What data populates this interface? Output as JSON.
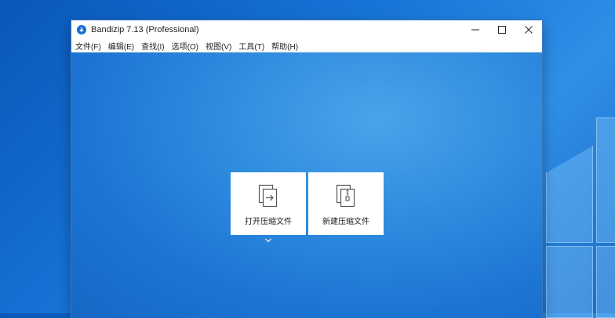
{
  "window": {
    "title": "Bandizip 7.13 (Professional)",
    "controls": {
      "minimize": "minimize-icon",
      "maximize": "maximize-icon",
      "close": "close-icon"
    }
  },
  "menu": [
    {
      "label": "文件(F)"
    },
    {
      "label": "编辑(E)"
    },
    {
      "label": "查找(I)"
    },
    {
      "label": "选项(O)"
    },
    {
      "label": "视图(V)"
    },
    {
      "label": "工具(T)"
    },
    {
      "label": "帮助(H)"
    }
  ],
  "actions": [
    {
      "label": "打开压缩文件",
      "icon": "open-archive-icon"
    },
    {
      "label": "新建压缩文件",
      "icon": "new-archive-icon"
    }
  ],
  "colors": {
    "accent": "#1a6fd1",
    "content_bg": "#2a87dc"
  }
}
